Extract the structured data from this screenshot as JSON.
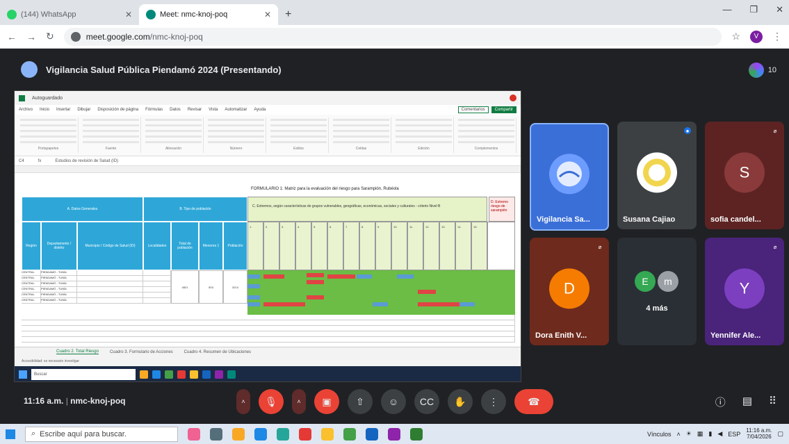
{
  "browser": {
    "tabs": [
      {
        "label": "(144) WhatsApp",
        "active": false
      },
      {
        "label": "Meet: nmc-knoj-poq",
        "active": true
      }
    ],
    "url_domain": "meet.google.com",
    "url_path": "/nmc-knoj-poq",
    "profile_initial": "V"
  },
  "meet": {
    "title": "Vigilancia Salud Pública Piendamó 2024 (Presentando)",
    "participant_count": "10",
    "time": "11:16 a.m.",
    "meeting_code": "nmc-knoj-poq"
  },
  "presentation": {
    "form_title": "FORMULARIO 1: Matriz para la evaluación del riesgo para Sarampión, Rubéola",
    "blue_headers": [
      "A. Datos Generales",
      "B. Tipo de población",
      "Región",
      "Departamento / distrito",
      "Municipio / Código de Salud (ID)",
      "Localidades",
      "Total de población",
      "Menores 1",
      "Población"
    ],
    "section_c": "C. Extremos, según características de grupos vulnerables, geográficas, económicas, sociales y culturales - criterio Nivel B",
    "section_d": "D. Extremo riesgo de sarampión",
    "sheet_tabs": [
      {
        "label": "Cuadro 2. Total Riesgo",
        "active": true
      },
      {
        "label": "Cuadro 3. Formulario de Acciones",
        "active": false
      },
      {
        "label": "Cuadro 4. Resumen de Ubicaciones",
        "active": false
      }
    ],
    "status_text": "Accesibilidad: es necesario investigar",
    "taskbar_search": "Buscar",
    "rows": [
      [
        "CENTRAL",
        "PIENDAMÓ - TUNÍA"
      ],
      [
        "CENTRAL",
        "PIENDAMÓ - TUNÍA"
      ],
      [
        "CENTRAL",
        "PIENDAMÓ - TUNÍA"
      ],
      [
        "CENTRAL",
        "PIENDAMÓ - TUNÍA"
      ],
      [
        "CENTRAL",
        "PIENDAMÓ - TUNÍA"
      ],
      [
        "CENTRAL",
        "PIENDAMÓ - TUNÍA"
      ]
    ]
  },
  "participants": [
    {
      "name": "Vigilancia Sa...",
      "initial": "",
      "color": "#4a7fe0",
      "bg": "#3b6fd8"
    },
    {
      "name": "Susana Cajiao",
      "initial": "",
      "color": "#f2d54f",
      "bg": "#3c4043"
    },
    {
      "name": "sofia candel...",
      "initial": "S",
      "color": "#8a3a3a",
      "bg": "#5d2323"
    },
    {
      "name": "Dora Enith V...",
      "initial": "D",
      "color": "#f57c00",
      "bg": "#6e2a1d"
    },
    {
      "name": "4 más",
      "initial": "E",
      "color": "#34a853",
      "bg": "#2a2f35"
    },
    {
      "name": "Yennifer Ale...",
      "initial": "Y",
      "color": "#7b3fbf",
      "bg": "#4a237a"
    }
  ],
  "extra_initial": "m",
  "taskbar": {
    "search_placeholder": "Escribe aquí para buscar.",
    "tray_links": "Vínculos",
    "lang": "ESP",
    "clock_time": "11:16 a.m.",
    "clock_date": "7/04/2026"
  }
}
